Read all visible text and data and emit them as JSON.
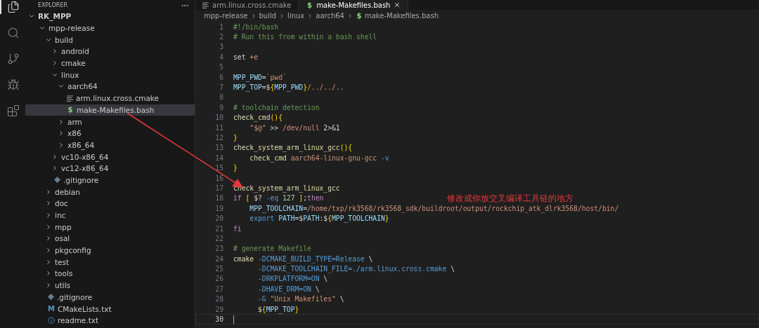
{
  "activity_bar": [
    {
      "kind": "explorer",
      "selected": true
    },
    {
      "kind": "search",
      "selected": false
    },
    {
      "kind": "source-control",
      "selected": false
    },
    {
      "kind": "run-debug",
      "selected": false
    },
    {
      "kind": "extensions",
      "selected": false
    }
  ],
  "explorer": {
    "title": "EXPLORER",
    "tree": [
      {
        "label": "RK_MPP",
        "kind": "folder",
        "expanded": true,
        "selected": false,
        "children": [
          {
            "label": "mpp-release",
            "kind": "folder",
            "expanded": true,
            "selected": false,
            "children": [
              {
                "label": "build",
                "kind": "folder",
                "expanded": true,
                "selected": false,
                "children": [
                  {
                    "label": "android",
                    "kind": "folder",
                    "expanded": false,
                    "selected": false
                  },
                  {
                    "label": "cmake",
                    "kind": "folder",
                    "expanded": false,
                    "selected": false
                  },
                  {
                    "label": "linux",
                    "kind": "folder",
                    "expanded": true,
                    "selected": false,
                    "children": [
                      {
                        "label": "aarch64",
                        "kind": "folder",
                        "expanded": true,
                        "selected": false,
                        "children": [
                          {
                            "label": "arm.linux.cross.cmake",
                            "kind": "cmake",
                            "selected": false
                          },
                          {
                            "label": "make-Makefiles.bash",
                            "kind": "shell",
                            "glyph": "$",
                            "selected": true
                          }
                        ]
                      },
                      {
                        "label": "arm",
                        "kind": "folder",
                        "expanded": false,
                        "selected": false
                      },
                      {
                        "label": "x86",
                        "kind": "folder",
                        "expanded": false,
                        "selected": false
                      },
                      {
                        "label": "x86_64",
                        "kind": "folder",
                        "expanded": false,
                        "selected": false
                      }
                    ]
                  },
                  {
                    "label": "vc10-x86_64",
                    "kind": "folder",
                    "expanded": false,
                    "selected": false
                  },
                  {
                    "label": "vc12-x86_64",
                    "kind": "folder",
                    "expanded": false,
                    "selected": false
                  },
                  {
                    "label": ".gitignore",
                    "kind": "git",
                    "selected": false
                  }
                ]
              },
              {
                "label": "debian",
                "kind": "folder",
                "expanded": false,
                "selected": false
              },
              {
                "label": "doc",
                "kind": "folder",
                "expanded": false,
                "selected": false
              },
              {
                "label": "inc",
                "kind": "folder",
                "expanded": false,
                "selected": false
              },
              {
                "label": "mpp",
                "kind": "folder",
                "expanded": false,
                "selected": false
              },
              {
                "label": "osal",
                "kind": "folder",
                "expanded": false,
                "selected": false
              },
              {
                "label": "pkgconfig",
                "kind": "folder",
                "expanded": false,
                "selected": false
              },
              {
                "label": "test",
                "kind": "folder",
                "expanded": false,
                "selected": false
              },
              {
                "label": "tools",
                "kind": "folder",
                "expanded": false,
                "selected": false
              },
              {
                "label": "utils",
                "kind": "folder",
                "expanded": false,
                "selected": false
              },
              {
                "label": ".gitignore",
                "kind": "git",
                "selected": false
              },
              {
                "label": "CMakeLists.txt",
                "kind": "cmakelists",
                "glyph": "M",
                "selected": false
              },
              {
                "label": "readme.txt",
                "kind": "info",
                "selected": false
              }
            ]
          }
        ]
      }
    ]
  },
  "tabs": [
    {
      "label": "arm.linux.cross.cmake",
      "kind": "cmake",
      "selected": false
    },
    {
      "label": "make-Makefiles.bash",
      "kind": "shell",
      "glyph": "$",
      "selected": true
    }
  ],
  "breadcrumb": [
    {
      "label": "mpp-release",
      "kind": "folder"
    },
    {
      "label": "build",
      "kind": "folder"
    },
    {
      "label": "linux",
      "kind": "folder"
    },
    {
      "label": "aarch64",
      "kind": "folder"
    },
    {
      "label": "make-Makefiles.bash",
      "kind": "shell",
      "glyph": "$"
    }
  ],
  "editor": {
    "lines": [
      {
        "number": "1",
        "current": false,
        "tokens": [
          {
            "kind": "c",
            "text": "#!/bin/bash"
          }
        ]
      },
      {
        "number": "2",
        "current": false,
        "tokens": [
          {
            "kind": "c",
            "text": "# Run this from within a bash shell"
          }
        ]
      },
      {
        "number": "3",
        "current": false
      },
      {
        "number": "4",
        "current": false,
        "tokens": [
          {
            "kind": "p",
            "text": "set "
          },
          {
            "kind": "s",
            "text": "+e"
          }
        ]
      },
      {
        "number": "5",
        "current": false
      },
      {
        "number": "6",
        "current": false,
        "tokens": [
          {
            "kind": "v",
            "text": "MPP_PWD"
          },
          {
            "kind": "p",
            "text": "="
          },
          {
            "kind": "s",
            "text": "`pwd`"
          }
        ]
      },
      {
        "number": "7",
        "current": false,
        "tokens": [
          {
            "kind": "v",
            "text": "MPP_TOP"
          },
          {
            "kind": "p",
            "text": "=$"
          },
          {
            "kind": "b",
            "text": "{"
          },
          {
            "kind": "v",
            "text": "MPP_PWD"
          },
          {
            "kind": "b",
            "text": "}"
          },
          {
            "kind": "s",
            "text": "/../../.."
          }
        ]
      },
      {
        "number": "8",
        "current": false
      },
      {
        "number": "9",
        "current": false,
        "tokens": [
          {
            "kind": "c",
            "text": "# toolchain detection"
          }
        ]
      },
      {
        "number": "10",
        "current": false,
        "tokens": [
          {
            "kind": "f",
            "text": "check_cmd"
          },
          {
            "kind": "b",
            "text": "(){"
          }
        ]
      },
      {
        "number": "11",
        "current": false,
        "tokens": [
          {
            "kind": "s",
            "text": "    \"$@\""
          },
          {
            "kind": "p",
            "text": " >> "
          },
          {
            "kind": "s",
            "text": "/dev/null"
          },
          {
            "kind": "p",
            "text": " 2>&1"
          }
        ]
      },
      {
        "number": "12",
        "current": false,
        "tokens": [
          {
            "kind": "b",
            "text": "}"
          }
        ]
      },
      {
        "number": "13",
        "current": false,
        "tokens": [
          {
            "kind": "f",
            "text": "check_system_arm_linux_gcc"
          },
          {
            "kind": "b",
            "text": "(){"
          }
        ]
      },
      {
        "number": "14",
        "current": false,
        "tokens": [
          {
            "kind": "f",
            "text": "    check_cmd"
          },
          {
            "kind": "s",
            "text": " aarch64-linux-gnu-gcc"
          },
          {
            "kind": "o",
            "text": " -v"
          }
        ]
      },
      {
        "number": "15",
        "current": false,
        "tokens": [
          {
            "kind": "b",
            "text": "}"
          }
        ]
      },
      {
        "number": "16",
        "current": false
      },
      {
        "number": "17",
        "current": false,
        "tokens": [
          {
            "kind": "f",
            "text": "check_system_arm_linux_gcc"
          }
        ]
      },
      {
        "number": "18",
        "current": false,
        "tokens": [
          {
            "kind": "k",
            "text": "if"
          },
          {
            "kind": "b",
            "text": " ["
          },
          {
            "kind": "p",
            "text": " $? "
          },
          {
            "kind": "o",
            "text": "-eq"
          },
          {
            "kind": "n",
            "text": " 127"
          },
          {
            "kind": "b",
            "text": " ]"
          },
          {
            "kind": "p",
            "text": ";"
          },
          {
            "kind": "k",
            "text": "then"
          }
        ]
      },
      {
        "number": "19",
        "current": false,
        "tokens": [
          {
            "kind": "v",
            "text": "    MPP_TOOLCHAIN"
          },
          {
            "kind": "p",
            "text": "="
          },
          {
            "kind": "s",
            "text": "/home/txp/rk3568/rk3568_sdk/buildroot/output/rockchip_atk_dlrk3568/host/bin/"
          }
        ]
      },
      {
        "number": "20",
        "current": false,
        "tokens": [
          {
            "kind": "o",
            "text": "    export"
          },
          {
            "kind": "v",
            "text": " PATH"
          },
          {
            "kind": "p",
            "text": "=$"
          },
          {
            "kind": "v",
            "text": "PATH"
          },
          {
            "kind": "p",
            "text": ":$"
          },
          {
            "kind": "b",
            "text": "{"
          },
          {
            "kind": "v",
            "text": "MPP_TOOLCHAIN"
          },
          {
            "kind": "b",
            "text": "}"
          }
        ]
      },
      {
        "number": "21",
        "current": false,
        "tokens": [
          {
            "kind": "k",
            "text": "fi"
          }
        ]
      },
      {
        "number": "22",
        "current": false
      },
      {
        "number": "23",
        "current": false,
        "tokens": [
          {
            "kind": "c",
            "text": "# generate Makefile"
          }
        ]
      },
      {
        "number": "24",
        "current": false,
        "tokens": [
          {
            "kind": "f",
            "text": "cmake"
          },
          {
            "kind": "o",
            "text": " -DCMAKE_BUILD_TYPE=Release"
          },
          {
            "kind": "p",
            "text": " \\"
          }
        ]
      },
      {
        "number": "25",
        "current": false,
        "tokens": [
          {
            "kind": "o",
            "text": "      -DCMAKE_TOOLCHAIN_FILE=./arm.linux.cross.cmake"
          },
          {
            "kind": "p",
            "text": " \\"
          }
        ]
      },
      {
        "number": "26",
        "current": false,
        "tokens": [
          {
            "kind": "o",
            "text": "      -DRKPLATFORM=ON"
          },
          {
            "kind": "p",
            "text": " \\"
          }
        ]
      },
      {
        "number": "27",
        "current": false,
        "tokens": [
          {
            "kind": "o",
            "text": "      -DHAVE_DRM=ON"
          },
          {
            "kind": "p",
            "text": " \\"
          }
        ]
      },
      {
        "number": "28",
        "current": false,
        "tokens": [
          {
            "kind": "o",
            "text": "      -G"
          },
          {
            "kind": "s",
            "text": " \"Unix Makefiles\""
          },
          {
            "kind": "p",
            "text": " \\"
          }
        ]
      },
      {
        "number": "29",
        "current": false,
        "tokens": [
          {
            "kind": "p",
            "text": "      $"
          },
          {
            "kind": "b",
            "text": "{"
          },
          {
            "kind": "v",
            "text": "MPP_TOP"
          },
          {
            "kind": "b",
            "text": "}"
          }
        ]
      },
      {
        "number": "30",
        "current": true
      }
    ]
  },
  "annotation": {
    "text": "修改成你放交叉编译工具链的地方"
  }
}
